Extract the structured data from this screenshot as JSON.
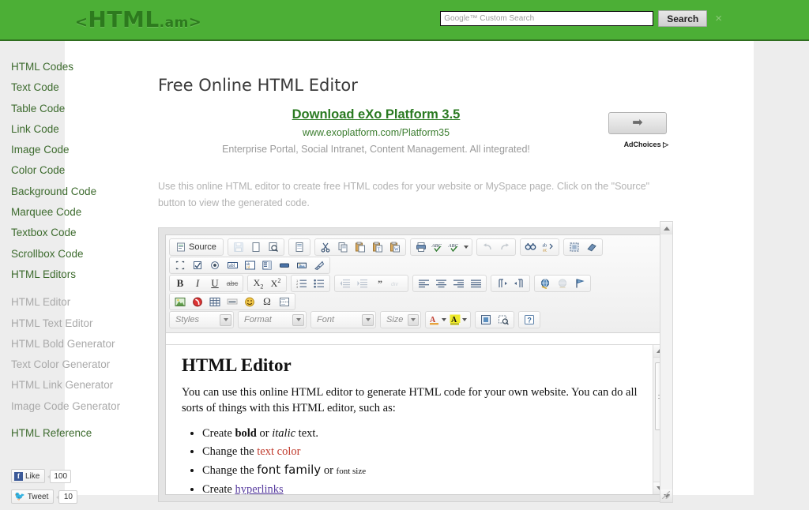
{
  "header": {
    "logo_lt": "<",
    "logo_main": "HTML",
    "logo_am": ".am",
    "logo_gt": ">",
    "brand_color": "#2d7a1e",
    "bar_color": "#4caf36",
    "search": {
      "placeholder": "Google™ Custom Search",
      "value": "",
      "button_label": "Search",
      "close_label": "×"
    }
  },
  "sidebar": {
    "items": [
      {
        "label": "HTML Codes",
        "style": "main"
      },
      {
        "label": "Text Code",
        "style": "main"
      },
      {
        "label": "Table Code",
        "style": "main"
      },
      {
        "label": "Link Code",
        "style": "main"
      },
      {
        "label": "Image Code",
        "style": "main"
      },
      {
        "label": "Color Code",
        "style": "main"
      },
      {
        "label": "Background Code",
        "style": "main"
      },
      {
        "label": "Marquee Code",
        "style": "main"
      },
      {
        "label": "Textbox Code",
        "style": "main"
      },
      {
        "label": "Scrollbox Code",
        "style": "main"
      },
      {
        "label": "HTML Editors",
        "style": "main"
      },
      {
        "label": "HTML Editor",
        "style": "sub"
      },
      {
        "label": "HTML Text Editor",
        "style": "sub"
      },
      {
        "label": "HTML Bold Generator",
        "style": "sub"
      },
      {
        "label": "Text Color Generator",
        "style": "sub"
      },
      {
        "label": "HTML Link Generator",
        "style": "sub"
      },
      {
        "label": "Image Code Generator",
        "style": "sub"
      },
      {
        "label": "HTML Reference",
        "style": "main"
      }
    ],
    "social": {
      "facebook_label": "Like",
      "facebook_glyph": "f",
      "facebook_count": "100",
      "twitter_label": "Tweet",
      "twitter_count": "10"
    }
  },
  "main": {
    "page_title": "Free Online HTML Editor",
    "ad": {
      "title": "Download eXo Platform 3.5",
      "url": "www.exoplatform.com/Platform35",
      "description": "Enterprise Portal, Social Intranet, Content Management. All integrated!",
      "button_arrow": "➡",
      "adchoices": "AdChoices ▷"
    },
    "intro": "Use this online HTML editor to create free HTML codes for your website or MySpace page. Click on the \"Source\" button to view the generated code."
  },
  "editor": {
    "toolbar": {
      "source_label": "Source",
      "rows": [
        {
          "groups": [
            {
              "buttons": [
                {
                  "name": "source-button",
                  "label": "Source",
                  "disabled": false
                }
              ]
            },
            {
              "buttons": [
                {
                  "name": "save-icon",
                  "disabled": true
                },
                {
                  "name": "new-page-icon",
                  "disabled": false
                },
                {
                  "name": "preview-icon",
                  "disabled": false
                }
              ]
            },
            {
              "buttons": [
                {
                  "name": "templates-icon",
                  "disabled": false
                }
              ]
            },
            {
              "buttons": [
                {
                  "name": "cut-icon",
                  "disabled": false
                },
                {
                  "name": "copy-icon",
                  "disabled": false
                },
                {
                  "name": "paste-icon",
                  "disabled": false
                },
                {
                  "name": "paste-text-icon",
                  "disabled": false
                },
                {
                  "name": "paste-word-icon",
                  "disabled": false
                }
              ]
            },
            {
              "buttons": [
                {
                  "name": "print-icon",
                  "disabled": false
                },
                {
                  "name": "spellcheck-icon",
                  "disabled": false
                },
                {
                  "name": "spellcheck-as-you-type-icon",
                  "disabled": false,
                  "dropdown": true
                }
              ]
            },
            {
              "buttons": [
                {
                  "name": "undo-icon",
                  "disabled": true
                },
                {
                  "name": "redo-icon",
                  "disabled": true
                }
              ]
            },
            {
              "buttons": [
                {
                  "name": "find-icon",
                  "disabled": false
                },
                {
                  "name": "replace-icon",
                  "disabled": false
                }
              ]
            },
            {
              "buttons": [
                {
                  "name": "select-all-icon",
                  "disabled": false
                },
                {
                  "name": "remove-format-icon",
                  "disabled": false
                }
              ]
            }
          ]
        },
        {
          "groups": [
            {
              "buttons": [
                {
                  "name": "form-icon",
                  "disabled": false
                },
                {
                  "name": "checkbox-icon",
                  "disabled": false
                },
                {
                  "name": "radio-button-icon",
                  "disabled": false
                },
                {
                  "name": "text-field-icon",
                  "disabled": false
                },
                {
                  "name": "textarea-icon",
                  "disabled": false
                },
                {
                  "name": "select-field-icon",
                  "disabled": false
                },
                {
                  "name": "form-button-icon",
                  "disabled": false
                },
                {
                  "name": "image-button-icon",
                  "disabled": false
                },
                {
                  "name": "hidden-field-icon",
                  "disabled": false
                }
              ]
            }
          ]
        },
        {
          "groups": [
            {
              "buttons": [
                {
                  "name": "bold-icon",
                  "label": "B",
                  "disabled": false
                },
                {
                  "name": "italic-icon",
                  "label": "I",
                  "disabled": false
                },
                {
                  "name": "underline-icon",
                  "label": "U",
                  "disabled": false
                },
                {
                  "name": "strikethrough-icon",
                  "label": "abc",
                  "disabled": false
                }
              ]
            },
            {
              "buttons": [
                {
                  "name": "subscript-icon",
                  "disabled": false
                },
                {
                  "name": "superscript-icon",
                  "disabled": false
                }
              ]
            },
            {
              "buttons": [
                {
                  "name": "numbered-list-icon",
                  "disabled": false
                },
                {
                  "name": "bulleted-list-icon",
                  "disabled": false
                }
              ]
            },
            {
              "buttons": [
                {
                  "name": "outdent-icon",
                  "disabled": true
                },
                {
                  "name": "indent-icon",
                  "disabled": false
                },
                {
                  "name": "blockquote-icon",
                  "disabled": false
                },
                {
                  "name": "create-div-icon",
                  "disabled": true
                }
              ]
            },
            {
              "buttons": [
                {
                  "name": "align-left-icon",
                  "disabled": false
                },
                {
                  "name": "align-center-icon",
                  "disabled": false
                },
                {
                  "name": "align-right-icon",
                  "disabled": false
                },
                {
                  "name": "justify-icon",
                  "disabled": false
                }
              ]
            },
            {
              "buttons": [
                {
                  "name": "text-direction-ltr-icon",
                  "disabled": false
                },
                {
                  "name": "text-direction-rtl-icon",
                  "disabled": false
                }
              ]
            },
            {
              "buttons": [
                {
                  "name": "link-icon",
                  "disabled": false
                },
                {
                  "name": "unlink-icon",
                  "disabled": true
                },
                {
                  "name": "anchor-icon",
                  "disabled": false
                }
              ]
            }
          ]
        },
        {
          "groups": [
            {
              "buttons": [
                {
                  "name": "image-icon",
                  "disabled": false
                },
                {
                  "name": "flash-icon",
                  "disabled": false
                },
                {
                  "name": "table-icon",
                  "disabled": false
                },
                {
                  "name": "horizontal-rule-icon",
                  "disabled": false
                },
                {
                  "name": "smiley-icon",
                  "disabled": false
                },
                {
                  "name": "special-character-icon",
                  "disabled": false
                },
                {
                  "name": "page-break-icon",
                  "disabled": false
                }
              ]
            }
          ]
        }
      ],
      "combos": [
        {
          "name": "styles-combo",
          "label": "Styles"
        },
        {
          "name": "format-combo",
          "label": "Format"
        },
        {
          "name": "font-combo",
          "label": "Font"
        },
        {
          "name": "size-combo",
          "label": "Size"
        }
      ],
      "color_buttons": [
        {
          "name": "text-color-button",
          "glyph": "A",
          "color": "#c0392b",
          "swatch": "#e8a33d"
        },
        {
          "name": "background-color-button",
          "glyph": "A",
          "color": "#000000",
          "swatch": "#eeea2a"
        }
      ],
      "tail_buttons": [
        {
          "name": "maximize-icon"
        },
        {
          "name": "show-blocks-icon"
        },
        {
          "name": "about-icon",
          "label": "?"
        }
      ]
    },
    "document": {
      "heading": "HTML Editor",
      "paragraph": "You can use this online HTML editor to generate HTML code for your own website. You can do all sorts of things with this HTML editor, such as:",
      "bullets": [
        {
          "parts": [
            {
              "text": "Create ",
              "style": "plain"
            },
            {
              "text": "bold",
              "style": "bold"
            },
            {
              "text": " or ",
              "style": "plain"
            },
            {
              "text": "italic",
              "style": "italic"
            },
            {
              "text": " text.",
              "style": "plain"
            }
          ]
        },
        {
          "parts": [
            {
              "text": "Change the ",
              "style": "plain"
            },
            {
              "text": "text color",
              "style": "color"
            }
          ]
        },
        {
          "parts": [
            {
              "text": "Change the ",
              "style": "plain"
            },
            {
              "text": "font family",
              "style": "family"
            },
            {
              "text": " or ",
              "style": "plain"
            },
            {
              "text": "font size",
              "style": "size"
            }
          ]
        },
        {
          "parts": [
            {
              "text": "Create ",
              "style": "plain"
            },
            {
              "text": "hyperlinks",
              "style": "link"
            }
          ]
        }
      ]
    }
  }
}
